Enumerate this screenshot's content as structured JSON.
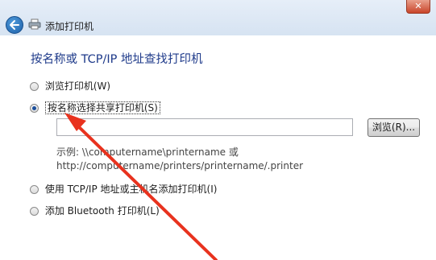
{
  "window": {
    "title": "添加打印机",
    "close_glyph": "✕"
  },
  "heading": "按名称或 TCP/IP 地址查找打印机",
  "options": [
    {
      "label": "浏览打印机(W)",
      "selected": false
    },
    {
      "label": "按名称选择共享打印机(S)",
      "selected": true
    },
    {
      "label": "使用 TCP/IP 地址或主机名添加打印机(I)",
      "selected": false
    },
    {
      "label": "添加 Bluetooth 打印机(L)",
      "selected": false
    }
  ],
  "share_input": {
    "value": ""
  },
  "browse_button": "浏览(R)...",
  "example": {
    "line1": "示例: \\\\computername\\printername 或",
    "line2": "http://computername/printers/printername/.printer"
  },
  "colors": {
    "heading": "#1e3a8a",
    "arrow": "#e8321e"
  }
}
